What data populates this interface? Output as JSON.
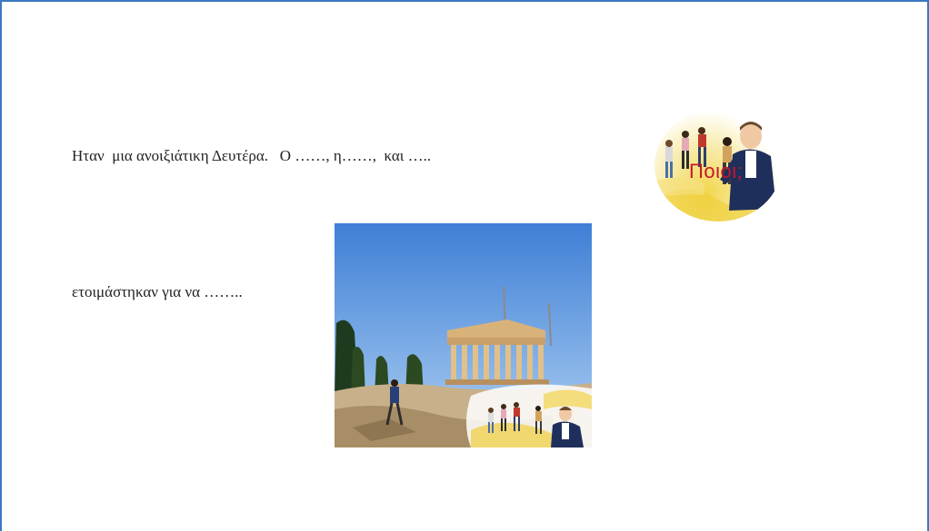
{
  "text": {
    "line1": "Ηταν  μια ανοιξιάτικη Δευτέρα.   Ο ……, η……,  και …..",
    "line2": "ετοιμάστηκαν για να …….."
  },
  "who_image": {
    "caption": "Ποιοι;"
  },
  "colors": {
    "border": "#3a78c2",
    "caption": "#c4182a",
    "sky": "#4a86d8"
  }
}
